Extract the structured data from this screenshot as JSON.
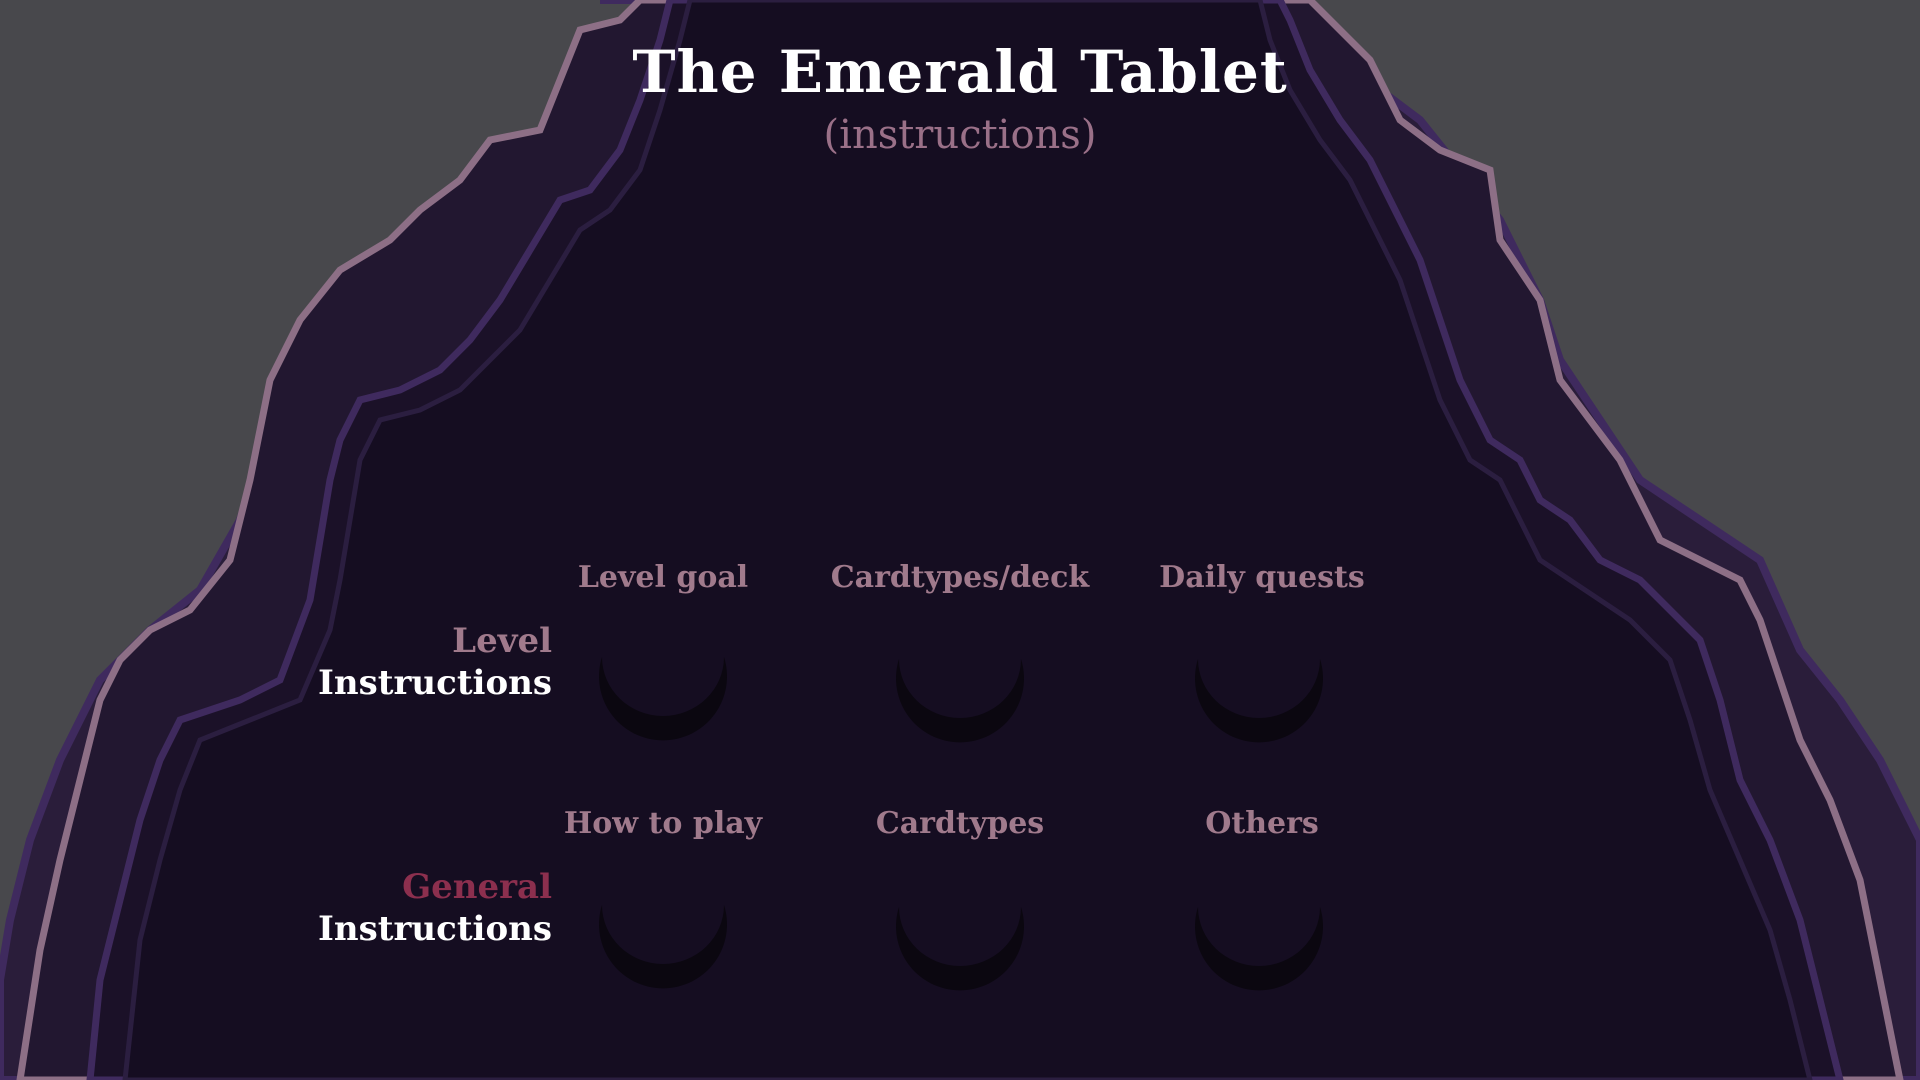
{
  "title": "The Emerald Tablet",
  "subtitle": "(instructions)",
  "colors": {
    "background_outer": "#48484c",
    "cave_fill": "#150d21",
    "cave_mid": "#221730",
    "outline_pink": "#8d6f86",
    "outline_purple": "#3f2a5e",
    "label_pink": "#a07a8c",
    "general_accent": "#8c2f4e",
    "text_white": "#ffffff",
    "moon": "#0b0710"
  },
  "rows": [
    {
      "first_word": "Level",
      "second_word": "Instructions",
      "accent": "#a07a8c",
      "items": [
        {
          "label": "Level goal",
          "icon": "crescent-moon-icon"
        },
        {
          "label": "Cardtypes/deck",
          "icon": "crescent-moon-icon"
        },
        {
          "label": "Daily quests",
          "icon": "crescent-moon-icon"
        }
      ]
    },
    {
      "first_word": "General",
      "second_word": "Instructions",
      "accent": "#8c2f4e",
      "items": [
        {
          "label": "How to play",
          "icon": "crescent-moon-icon"
        },
        {
          "label": "Cardtypes",
          "icon": "crescent-moon-icon"
        },
        {
          "label": "Others",
          "icon": "crescent-moon-icon"
        }
      ]
    }
  ]
}
